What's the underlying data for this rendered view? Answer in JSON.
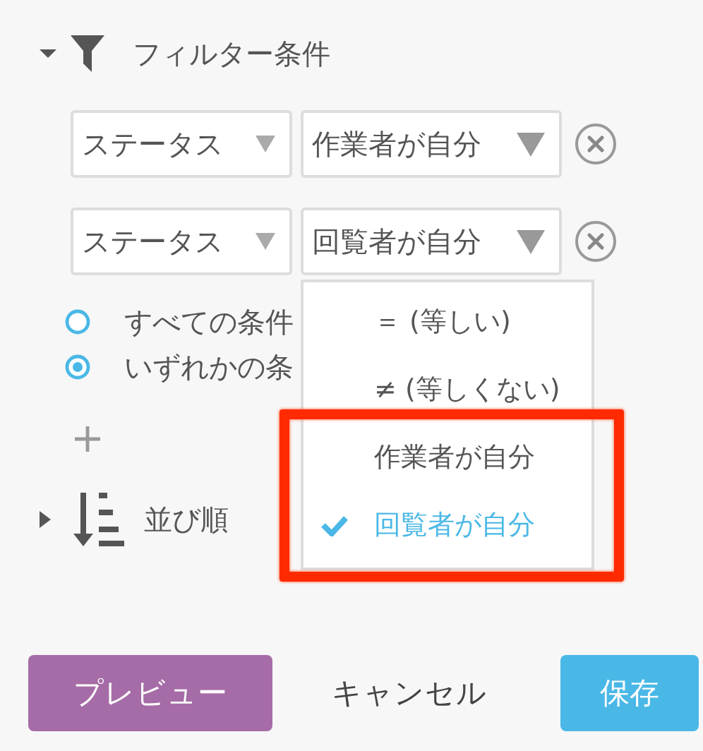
{
  "filter_section": {
    "title": "フィルター条件",
    "expanded": true,
    "conditions": [
      {
        "field": "ステータス",
        "operator": "作業者が自分",
        "open": false
      },
      {
        "field": "ステータス",
        "operator": "回覧者が自分",
        "open": true
      }
    ],
    "dropdown": {
      "options": [
        {
          "label": "＝ (等しい)",
          "selected": false,
          "highlighted": false
        },
        {
          "label": "≠ (等しくない)",
          "selected": false,
          "highlighted": false
        },
        {
          "label": "作業者が自分",
          "selected": false,
          "highlighted": true
        },
        {
          "label": "回覧者が自分",
          "selected": true,
          "highlighted": true
        }
      ]
    },
    "match_options": [
      {
        "label": "すべての条件",
        "selected": false
      },
      {
        "label": "いずれかの条",
        "selected": true
      }
    ]
  },
  "sort_section": {
    "title": "並び順",
    "expanded": false
  },
  "buttons": [
    {
      "label": "プレビュー",
      "kind": "primary"
    },
    {
      "label": "キャンセル",
      "kind": "plain"
    },
    {
      "label": "保存",
      "kind": "accent"
    }
  ]
}
